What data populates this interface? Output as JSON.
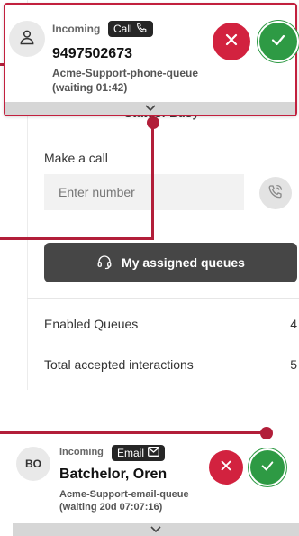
{
  "background_panel": {
    "status_text": "Status: Busy",
    "make_call_label": "Make a call",
    "number_placeholder": "Enter number",
    "dial_icon": "phone-dial-icon",
    "queues_button_label": "My assigned queues",
    "queues_icon": "headset-icon",
    "stats": [
      {
        "label": "Enabled Queues",
        "value": "4"
      },
      {
        "label": "Total accepted interactions",
        "value": "5"
      }
    ]
  },
  "call_notification": {
    "avatar_icon": "user-icon",
    "incoming_label": "Incoming",
    "type_label": "Call",
    "type_icon": "phone-icon",
    "phone_number": "9497502673",
    "queue_name": "Acme-Support-phone-queue",
    "waiting": "(waiting 01:42)",
    "reject_icon": "close-icon",
    "accept_icon": "check-icon",
    "expand_icon": "chevron-down-icon"
  },
  "email_notification": {
    "avatar_initials": "BO",
    "incoming_label": "Incoming",
    "type_label": "Email",
    "type_icon": "envelope-icon",
    "sender_name": "Batchelor, Oren",
    "queue_name": "Acme-Support-email-queue",
    "waiting": "(waiting 20d 07:07:16)",
    "reject_icon": "close-icon",
    "accept_icon": "check-icon",
    "expand_icon": "chevron-down-icon"
  },
  "colors": {
    "accent_red": "#c2203e",
    "accept_green": "#2e9a44",
    "dark_button": "#464646"
  }
}
